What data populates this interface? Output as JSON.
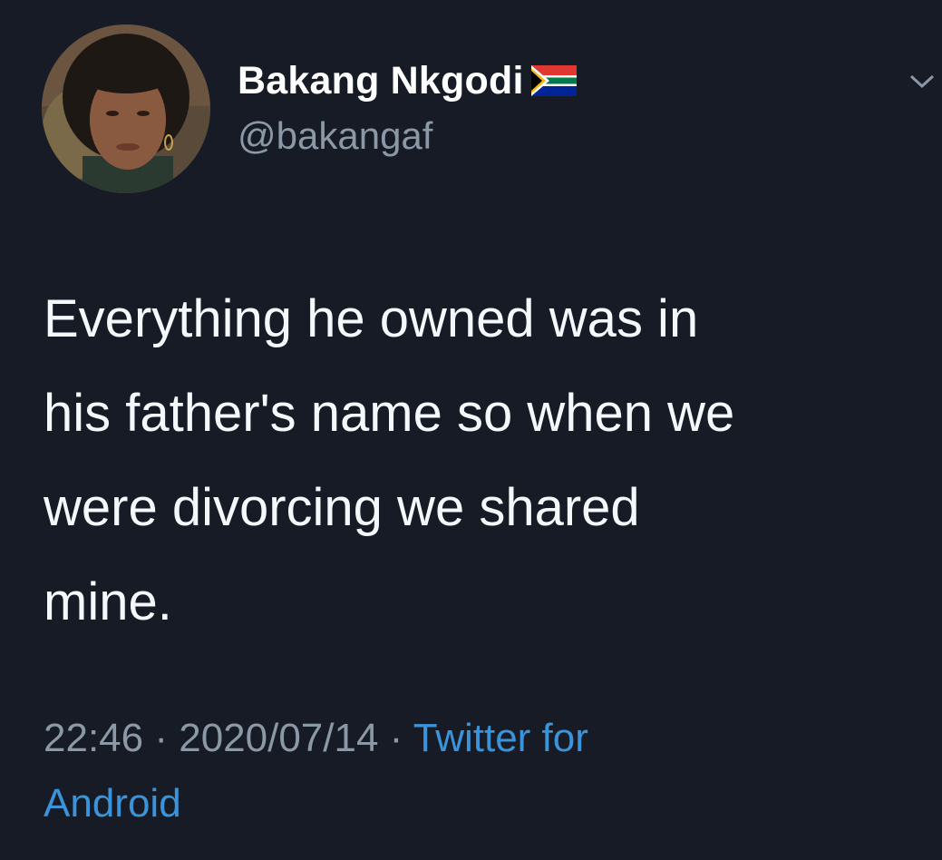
{
  "author": {
    "display_name": "Bakang Nkgodi",
    "handle": "@bakangaf",
    "flag_icon": "south-africa-flag-icon"
  },
  "tweet": {
    "text": "Everything he owned was in\nhis father's name so when we\nwere divorcing we shared\nmine."
  },
  "meta": {
    "time": "22:46",
    "separator": " · ",
    "date": "2020/07/14",
    "source_line1": "Twitter for",
    "source_line2": "Android"
  },
  "icons": {
    "menu": "chevron-down-icon",
    "avatar": "avatar"
  },
  "colors": {
    "background": "#161b26",
    "text": "#f5f8fa",
    "secondary": "#8b98a5",
    "link": "#3b94d9"
  }
}
